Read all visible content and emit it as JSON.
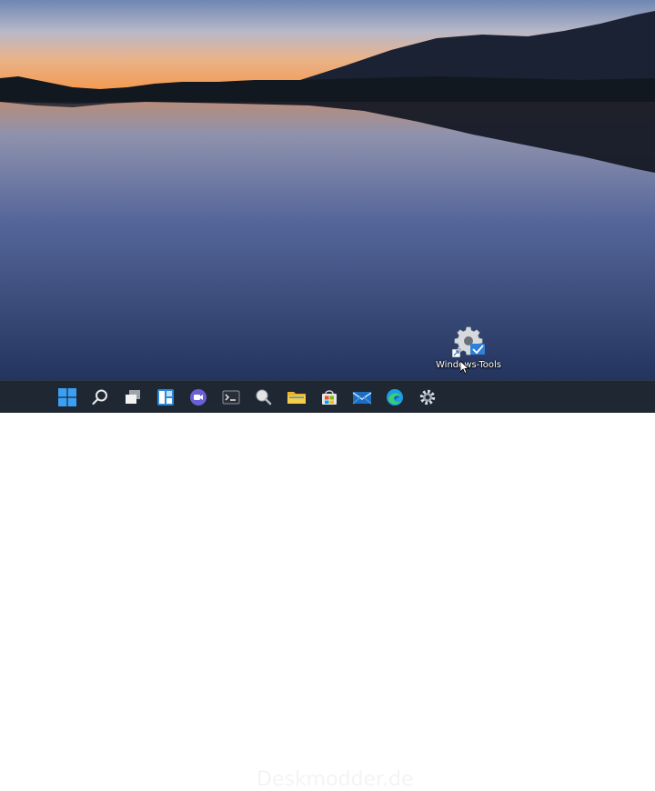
{
  "desktop": {
    "shortcut": {
      "label": "Windows-Tools",
      "icon": "gear-icon"
    }
  },
  "taskbar": {
    "items": [
      {
        "name": "start-button",
        "icon": "windows-logo-icon"
      },
      {
        "name": "search-button",
        "icon": "search-icon"
      },
      {
        "name": "task-view-button",
        "icon": "task-view-icon"
      },
      {
        "name": "widgets-button",
        "icon": "widgets-icon"
      },
      {
        "name": "chat-button",
        "icon": "teams-chat-icon"
      },
      {
        "name": "terminal-button",
        "icon": "terminal-icon"
      },
      {
        "name": "search-app-button",
        "icon": "magnifier-app-icon"
      },
      {
        "name": "file-explorer-button",
        "icon": "folder-icon"
      },
      {
        "name": "store-button",
        "icon": "store-icon"
      },
      {
        "name": "mail-button",
        "icon": "mail-icon"
      },
      {
        "name": "edge-button",
        "icon": "edge-icon"
      },
      {
        "name": "settings-button",
        "icon": "gear-icon"
      }
    ]
  },
  "watermark": "Deskmodder.de",
  "colors": {
    "taskbar": "#1f2733",
    "accent": "#3a9ff0"
  }
}
